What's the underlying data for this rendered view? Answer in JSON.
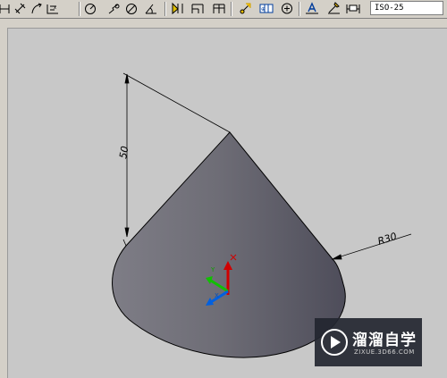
{
  "toolbar": {
    "dim_style_value": "ISO-25"
  },
  "drawing": {
    "height_dim_text": "50",
    "radius_dim_text": "R30"
  },
  "watermark": {
    "title": "溜溜自学",
    "subtitle": "ZIXUE.3D66.COM"
  },
  "ucs": {
    "x_label": "X",
    "y_label": "Y"
  }
}
